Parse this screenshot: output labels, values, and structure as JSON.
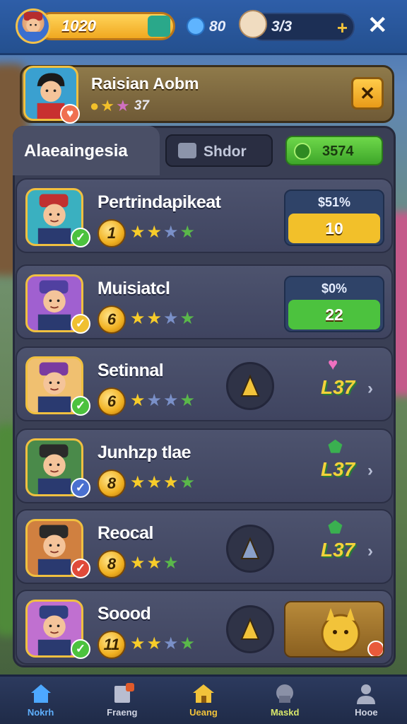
{
  "topbar": {
    "coins": "1020",
    "gems": "80",
    "energy": "3/3",
    "plus_label": "+",
    "close_label": "✕"
  },
  "header": {
    "title": "Raisian Aobm",
    "rating_text": "37",
    "close_label": "✕"
  },
  "tabs": {
    "active_label": "Alaeaingesia",
    "second_label": "Shdor",
    "currency_value": "3574"
  },
  "rows": [
    {
      "name": "Pertrindapikeat",
      "level": "1",
      "stars": 4,
      "filled": 2,
      "price_top": "$51%",
      "price_btn": "10",
      "btn_color": "#f2c02a"
    },
    {
      "name": "Muisiatcl",
      "level": "6",
      "stars": 4,
      "filled": 2,
      "price_top": "$0%",
      "price_btn": "22",
      "btn_color": "#4cc23e"
    },
    {
      "name": "Setinnal",
      "level": "6",
      "stars": 4,
      "filled": 1,
      "right_level": "L37"
    },
    {
      "name": "Junhzp tlae",
      "level": "8",
      "stars": 4,
      "filled": 3,
      "right_level": "L37"
    },
    {
      "name": "Reocal",
      "level": "8",
      "stars": 3,
      "filled": 2,
      "right_level": "L37"
    },
    {
      "name": "Soood",
      "level": "11",
      "stars": 4,
      "filled": 2
    }
  ],
  "icons": {
    "coin": "coin-icon",
    "gem": "gem-icon",
    "energy": "pie-icon",
    "chevron": "chevron-right-icon"
  },
  "nav": [
    {
      "label": "Nokrh",
      "color": "#5fb0ff"
    },
    {
      "label": "Fraeng",
      "color": "#d0d4e2"
    },
    {
      "label": "Ueang",
      "color": "#f2c33a"
    },
    {
      "label": "Maskd",
      "color": "#d9e86a"
    },
    {
      "label": "Hooe",
      "color": "#d0d4e2"
    }
  ]
}
